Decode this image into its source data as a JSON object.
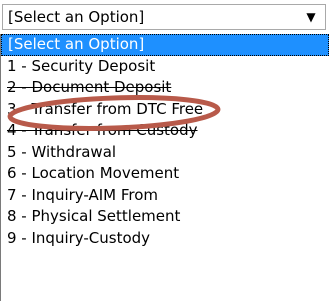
{
  "select": {
    "value": "[Select an Option]",
    "arrow_icon": "down-triangle-icon"
  },
  "options": [
    {
      "label": "[Select an Option]",
      "selected": true
    },
    {
      "label": "1 - Security Deposit"
    },
    {
      "label": "2 - Document Deposit",
      "strike": true
    },
    {
      "label": "3 - Transfer from DTC Free"
    },
    {
      "label": "4 - Transfer from Custody",
      "strike": true
    },
    {
      "label": "5 - Withdrawal"
    },
    {
      "label": "6 - Location Movement"
    },
    {
      "label": "7 - Inquiry-AIM From"
    },
    {
      "label": "8 - Physical Settlement"
    },
    {
      "label": "9 - Inquiry-Custody"
    }
  ],
  "colors": {
    "selected_bg": "#1e90ff",
    "annotation": "#b85a4a"
  }
}
